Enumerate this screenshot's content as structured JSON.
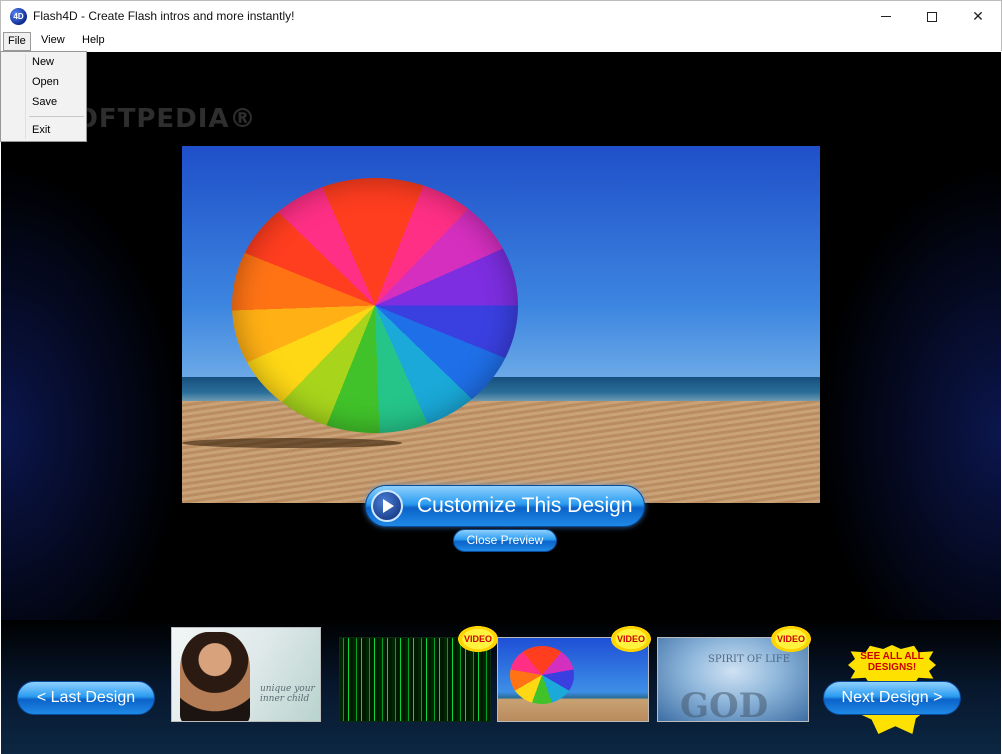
{
  "window": {
    "app_icon_label": "4D",
    "title": "Flash4D - Create Flash intros and more instantly!",
    "minimize_label": "",
    "maximize_label": "",
    "close_label": "✕"
  },
  "menubar": {
    "items": [
      "File",
      "View",
      "Help"
    ]
  },
  "file_menu": {
    "items": [
      "New",
      "Open",
      "Save",
      "Exit"
    ]
  },
  "watermark": "SOFTPEDIA®",
  "preview": {
    "customize_label": "Customize This Design",
    "close_preview_label": "Close Preview"
  },
  "designs": {
    "last_label": "< Last Design",
    "next_label": "Next Design >",
    "see_all_label": "SEE ALL ALL DESIGNS!",
    "video_badge": "VIDEO",
    "thumb_1_text": "unique your inner child",
    "thumb_4_small": "SPIRIT OF LIFE",
    "thumb_4_big": "GOD"
  },
  "colors": {
    "button_blue": "#1f8ae6",
    "badge_yellow": "#ffe100",
    "badge_red": "#cc0000",
    "stage_bg": "#000000"
  }
}
